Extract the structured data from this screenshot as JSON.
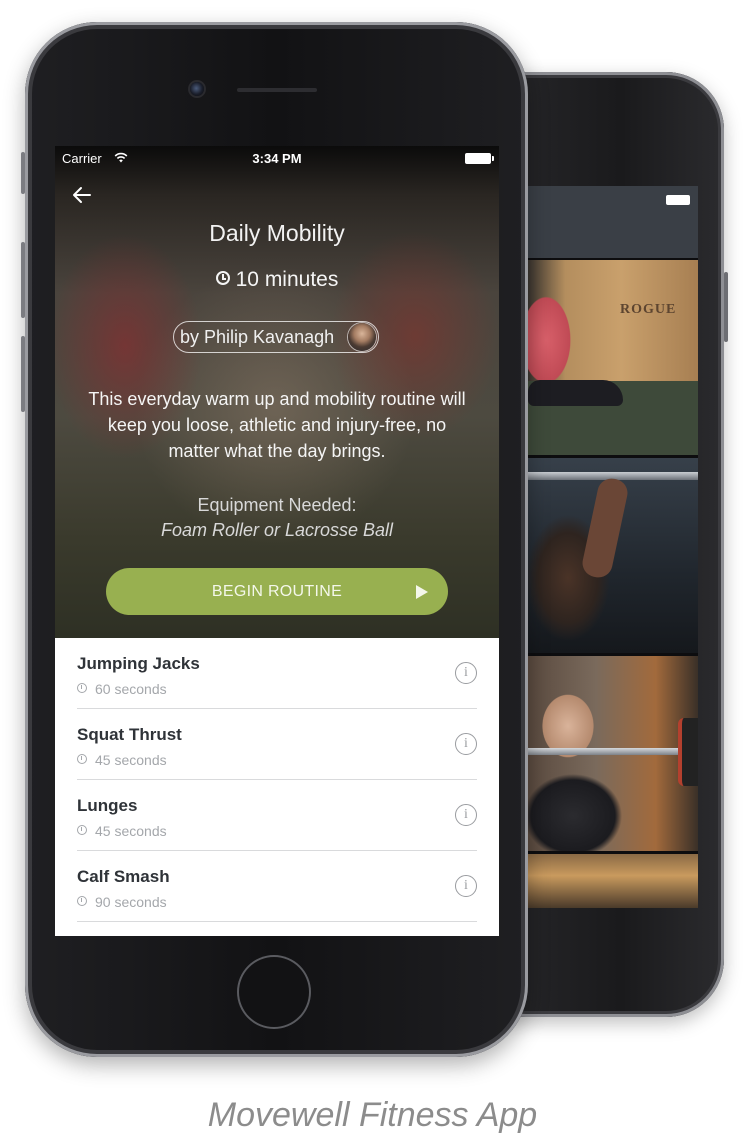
{
  "status_bar": {
    "carrier": "Carrier",
    "time": "3:34 PM"
  },
  "routine": {
    "title": "Daily Mobility",
    "duration": "10 minutes",
    "author": "by Philip Kavanagh",
    "description": "This everyday warm up and mobility routine will keep you loose, athletic and injury-free, no matter what the day brings.",
    "equipment_label": "Equipment Needed:",
    "equipment": "Foam Roller or Lacrosse Ball",
    "begin_label": "BEGIN ROUTINE"
  },
  "exercises": [
    {
      "name": "Jumping Jacks",
      "duration": "60 seconds"
    },
    {
      "name": "Squat Thrust",
      "duration": "45 seconds"
    },
    {
      "name": "Lunges",
      "duration": "45 seconds"
    },
    {
      "name": "Calf Smash",
      "duration": "90 seconds"
    }
  ],
  "back_screen": {
    "photo_text": "ROGUE"
  },
  "caption": "Movewell Fitness App",
  "colors": {
    "accent_green": "#98b050",
    "text_dark": "#2f3338",
    "text_muted": "#a4a7ab"
  },
  "icons": [
    "wifi-icon",
    "battery-icon",
    "back-arrow-icon",
    "clock-icon",
    "play-icon",
    "info-icon"
  ]
}
